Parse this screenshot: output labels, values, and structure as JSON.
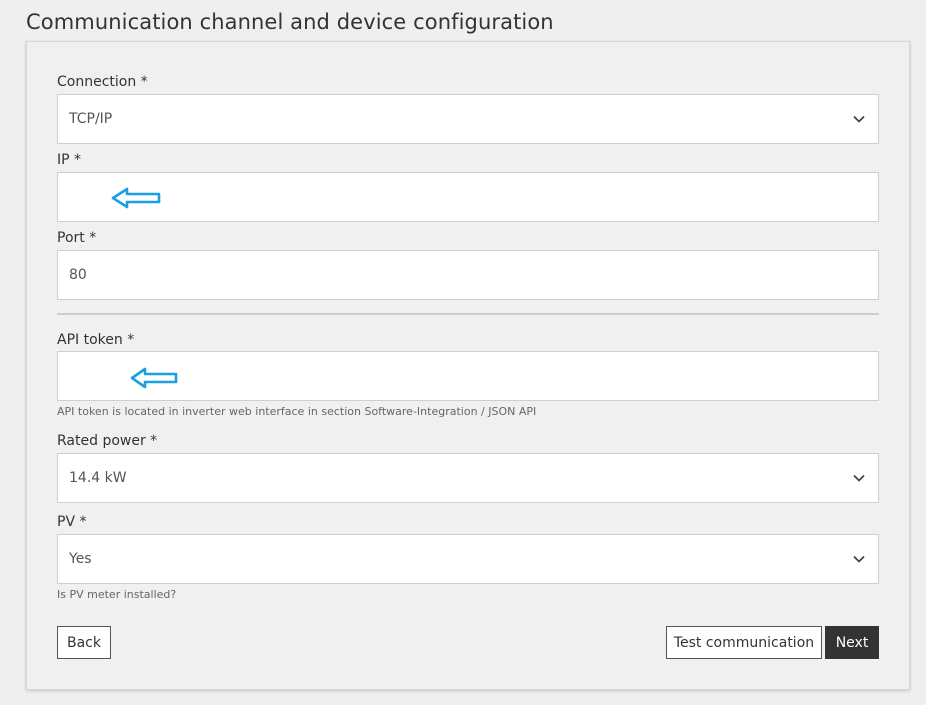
{
  "page": {
    "title": "Communication channel and device configuration"
  },
  "form": {
    "connection": {
      "label": "Connection *",
      "value": "TCP/IP"
    },
    "ip": {
      "label": "IP *",
      "value": ""
    },
    "port": {
      "label": "Port *",
      "value": "80"
    },
    "api_token": {
      "label": "API token *",
      "value": "",
      "help": "API token is located in inverter web interface in section Software-Integration / JSON API"
    },
    "rated_power": {
      "label": "Rated power *",
      "value": "14.4 kW"
    },
    "pv": {
      "label": "PV *",
      "value": "Yes",
      "help": "Is PV meter installed?"
    }
  },
  "actions": {
    "back_label": "Back",
    "test_label": "Test communication",
    "next_label": "Next"
  },
  "annotation": {
    "arrow_color": "#1a9fe0"
  }
}
